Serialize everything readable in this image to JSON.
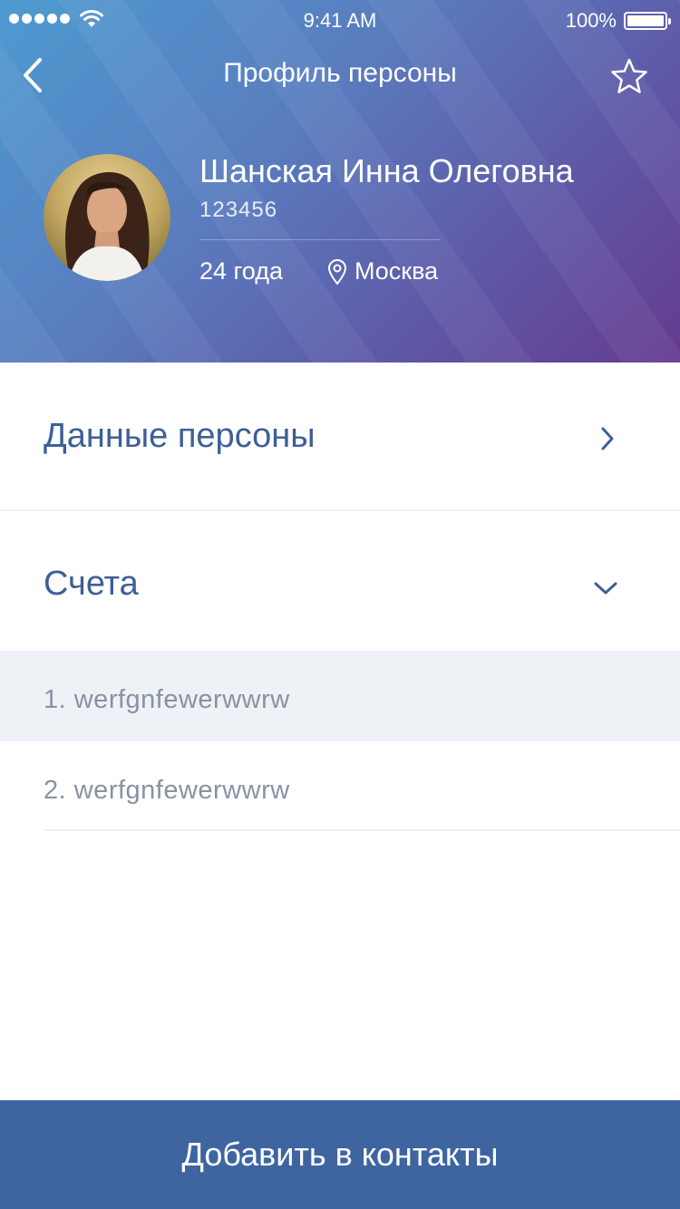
{
  "status_bar": {
    "time": "9:41 AM",
    "battery": "100%"
  },
  "nav": {
    "title": "Профиль персоны",
    "back_icon": "chevron-left-icon",
    "favorite_icon": "star-icon"
  },
  "person": {
    "name": "Шанская Инна Олеговна",
    "id": "123456",
    "age": "24 года",
    "city": "Москва",
    "city_icon": "map-pin-icon"
  },
  "sections": {
    "person_data_label": "Данные персоны",
    "accounts_label": "Счета"
  },
  "accounts": [
    "1. werfgnfewerwwrw",
    "2. werfgnfewerwwrw"
  ],
  "actions": {
    "add_contact_label": "Добавить в контакты"
  },
  "colors": {
    "accent": "#3e65a0",
    "section_text": "#3e5f96",
    "header_gradient_start": "#4d9bd0",
    "header_gradient_end": "#643b8f"
  }
}
